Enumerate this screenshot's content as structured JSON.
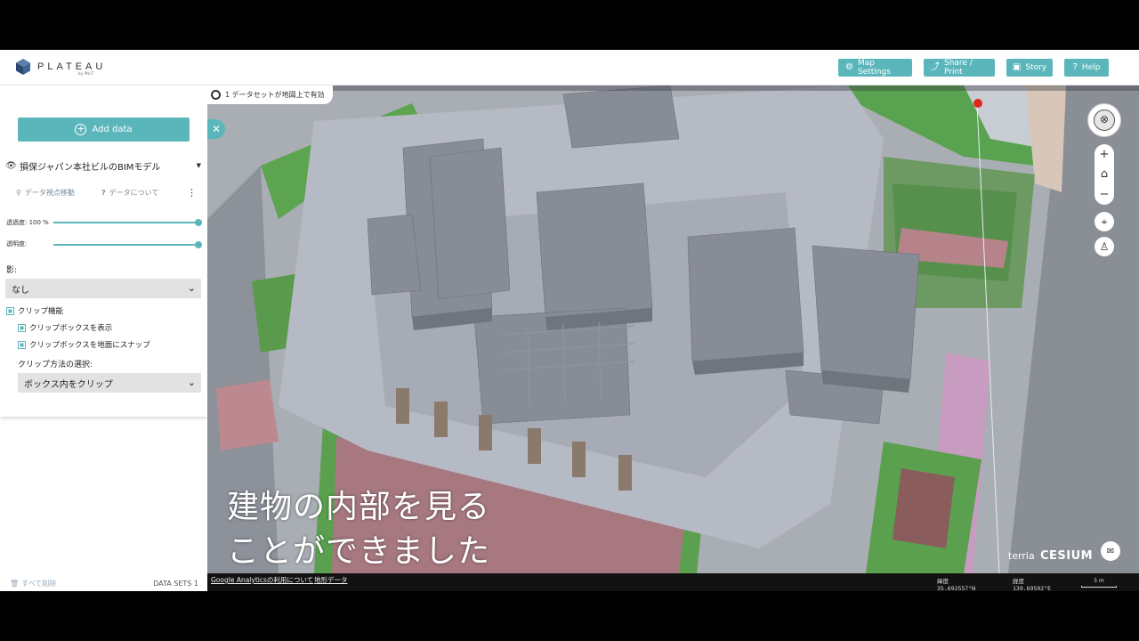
{
  "header": {
    "logo_text": "PLATEAU",
    "logo_sub": "by MLIT",
    "buttons": [
      {
        "label": "Map Settings",
        "icon": "sliders-icon"
      },
      {
        "label": "Share / Print",
        "icon": "share-icon"
      },
      {
        "label": "Story",
        "icon": "story-icon"
      },
      {
        "label": "Help",
        "icon": "help-icon"
      }
    ]
  },
  "panel": {
    "add_data_label": "Add data",
    "layer_name": "損保ジャパン本社ビルのBIMモデル",
    "action_zoom": "データ視点移動",
    "action_about": "データについて",
    "opacity_label": "透過度: 100 %",
    "opacity_value": 1.0,
    "transparency_label": "透明度:",
    "transparency_value": 1.0,
    "shadow_label": "影:",
    "shadow_value": "なし",
    "clip_label": "クリップ機能",
    "clip_show_box": "クリップボックスを表示",
    "clip_snap": "クリップボックスを地面にスナップ",
    "clip_method_label": "クリップ方法の選択:",
    "clip_method_value": "ボックス内をクリップ",
    "clear_all": "すべて削除",
    "datasets_count": "DATA SETS 1"
  },
  "map": {
    "status": "1 データセットが地図上で有効",
    "subtitle_line1": "建物の内部を見る",
    "subtitle_line2": "ことができました",
    "terria": "terria",
    "cesium": "CESIUM"
  },
  "footer": {
    "analytics_link": "Google Analyticsの利用について",
    "map_data_link": "地形データ",
    "lat_label": "緯度",
    "lat_value": "35.692557°N",
    "lon_label": "経度",
    "lon_value": "139.69592°E",
    "scale_label": "5 m"
  },
  "colors": {
    "accent": "#5bb6bc",
    "green_area": "#4f9a47",
    "pink_area": "#b38a8f",
    "floor": "#b8bcc6"
  }
}
